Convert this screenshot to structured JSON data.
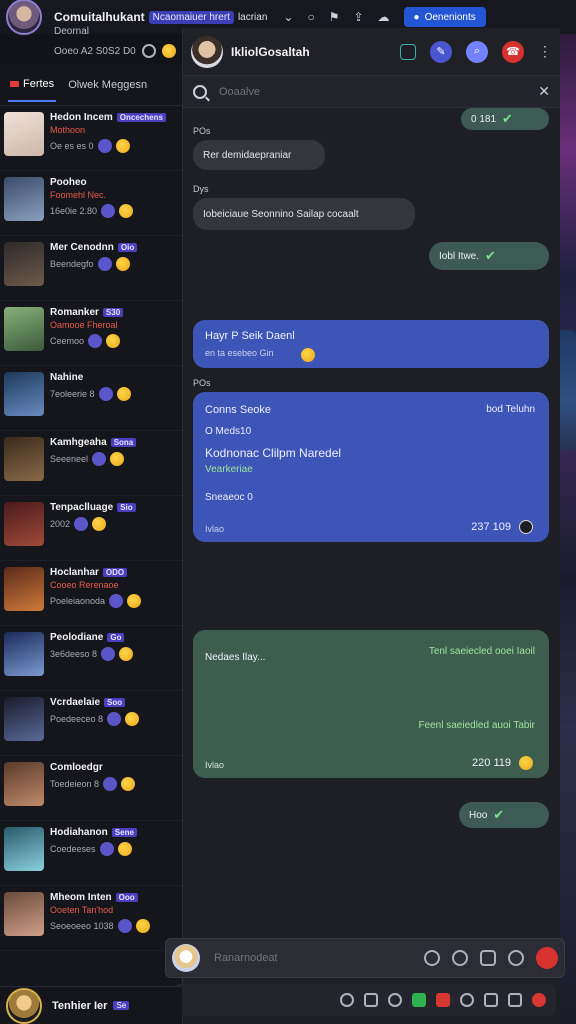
{
  "topbar": {
    "title": "Comuitalhukant",
    "tag": "Ncaomaiuer hrert",
    "subtitle": "lacrian",
    "button_label": "Oenenionts"
  },
  "user": {
    "status": "Deornal",
    "info": "Ooeo A2 S0S2 D0"
  },
  "sidebar": {
    "tabs": [
      {
        "label": "Fertes"
      },
      {
        "label": "Olwek Meggesn"
      }
    ],
    "conversations": [
      {
        "name": "Hedon Incem",
        "badge": "Oncechens",
        "line2": "Mothoon",
        "line3": "Oe es es 0"
      },
      {
        "name": "Pooheo",
        "badge": "",
        "line2": "Foomehl Nec.",
        "line3": "16e0ie 2.80"
      },
      {
        "name": "Mer Cenodnn",
        "badge": "Oio",
        "line2": "",
        "line3": "Beendegfo"
      },
      {
        "name": "Romanker",
        "badge": "S30",
        "line2": "Oamooe Fheroal",
        "line3": "Ceemoo"
      },
      {
        "name": "Nahine",
        "badge": "",
        "line2": "",
        "line3": "7eoleerie 8"
      },
      {
        "name": "Kamhgeaha",
        "badge": "Sona",
        "line2": "",
        "line3": "Seeeneel"
      },
      {
        "name": "Tenpaclluage",
        "badge": "Sio",
        "line2": "",
        "line3": "2002"
      },
      {
        "name": "Hoclanhar",
        "badge": "ODO",
        "line2": "Cooeo Rerenaoe",
        "line3": "Poeleiaonoda"
      },
      {
        "name": "Peolodiane",
        "badge": "Go",
        "line2": "",
        "line3": "3e6deeso 8"
      },
      {
        "name": "Vcrdaelaie",
        "badge": "Soo",
        "line2": "",
        "line3": "Poedeeceo 8"
      },
      {
        "name": "Comloedgr",
        "badge": "",
        "line2": "",
        "line3": "Toedeieon 8"
      },
      {
        "name": "Hodiahanon",
        "badge": "Sene",
        "line2": "",
        "line3": "Coedeeses"
      },
      {
        "name": "Mheom Inten",
        "badge": "Ooo",
        "line2": "Ooeten Tan'hod",
        "line3": "Seoeoeeo 1038"
      }
    ]
  },
  "chat": {
    "contact_name": "IkliolGosaltah",
    "search_placeholder": "Ooaalve",
    "messages": {
      "m1_pill": "0 181",
      "s1": "POs",
      "m2": "Rer demidaepraniar",
      "s2": "Dys",
      "m3": "Iobeiciaue Seonnino Sailap cocaalt",
      "m4_pill": "Iobl Itwe.",
      "m5_line1": "Hayr P Seik Daenl",
      "m5_line2": "en ta esebeo Gin",
      "s3": "POs",
      "card_title": "Conns Seoke",
      "card_meta": "bod Teluhn",
      "card_line1": "O Meds10",
      "card_heading": "Kodnonac Clilpm Naredel",
      "card_green": "Vearkeriae",
      "card_line2": "Sneaeoc 0",
      "card_foot_left": "Ivlao",
      "card_time": "237 109",
      "g_left": "Nedaes Ilay...",
      "g_right1": "Tenl saeiecled ooei Iaoil",
      "g_right2": "Feenl saeiedled auoi Tabir",
      "g_foot_left": "Ivlao",
      "g_time": "220 119",
      "m6_pill": "Hoo"
    }
  },
  "composer": {
    "placeholder": "Ranarnodeat"
  },
  "bottom_user": {
    "name": "Tenhier Ier",
    "badge": "Se"
  },
  "colors": {
    "accent": "#2355d4",
    "bubble_blue": "#3c55b7",
    "bubble_green": "#3d5e4e",
    "danger": "#d8322f"
  }
}
